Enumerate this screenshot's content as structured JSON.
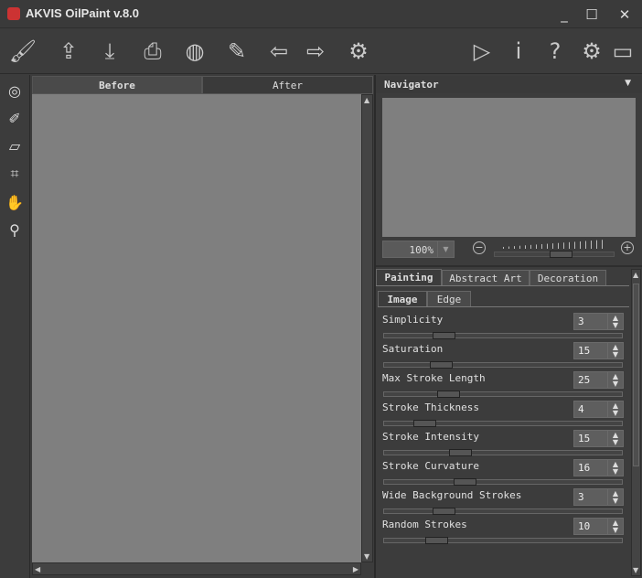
{
  "window": {
    "title": "AKVIS OilPaint v.8.0",
    "minimize": "_",
    "maximize": "☐",
    "close": "✕"
  },
  "toolbar": {
    "left": [
      {
        "icon": "brush-logo-icon",
        "glyph": "🖌"
      },
      {
        "icon": "open-icon",
        "glyph": "⇪"
      },
      {
        "icon": "save-icon",
        "glyph": "⤓"
      },
      {
        "icon": "print-icon",
        "glyph": "⎙"
      },
      {
        "icon": "share-icon",
        "glyph": "◍"
      },
      {
        "icon": "batch-icon",
        "glyph": "✎"
      },
      {
        "icon": "undo-icon",
        "glyph": "⇦"
      },
      {
        "icon": "redo-icon",
        "glyph": "⇨"
      },
      {
        "icon": "settings-gears-icon",
        "glyph": "⚙"
      }
    ],
    "right": [
      {
        "icon": "run-icon",
        "glyph": "▷"
      },
      {
        "icon": "info-icon",
        "glyph": "i"
      },
      {
        "icon": "help-icon",
        "glyph": "?"
      },
      {
        "icon": "preferences-icon",
        "glyph": "⚙"
      },
      {
        "icon": "comment-icon",
        "glyph": "▭"
      }
    ]
  },
  "tools": [
    {
      "icon": "painting-tool-icon",
      "glyph": "◎"
    },
    {
      "icon": "direction-brush-icon",
      "glyph": "✐"
    },
    {
      "icon": "eraser-icon",
      "glyph": "▱"
    },
    {
      "icon": "crop-icon",
      "glyph": "⌗"
    },
    {
      "icon": "hand-icon",
      "glyph": "✋"
    },
    {
      "icon": "zoom-icon",
      "glyph": "⚲"
    }
  ],
  "view_tabs": {
    "before": "Before",
    "after": "After",
    "active": "Before"
  },
  "navigator": {
    "title": "Navigator",
    "zoom": "100%",
    "zoom_slider": 0.55
  },
  "settings": {
    "tabs": [
      "Painting",
      "Abstract Art",
      "Decoration"
    ],
    "active_tab": "Painting",
    "subtabs": [
      "Image",
      "Edge"
    ],
    "active_subtab": "Image",
    "params": [
      {
        "label": "Simplicity",
        "value": "3",
        "slider": 0.25
      },
      {
        "label": "Saturation",
        "value": "15",
        "slider": 0.24
      },
      {
        "label": "Max Stroke Length",
        "value": "25",
        "slider": 0.27
      },
      {
        "label": "Stroke Thickness",
        "value": "4",
        "slider": 0.17
      },
      {
        "label": "Stroke Intensity",
        "value": "15",
        "slider": 0.32
      },
      {
        "label": "Stroke Curvature",
        "value": "16",
        "slider": 0.34
      },
      {
        "label": "Wide Background Strokes",
        "value": "3",
        "slider": 0.25
      },
      {
        "label": "Random Strokes",
        "value": "10",
        "slider": 0.22
      }
    ]
  }
}
